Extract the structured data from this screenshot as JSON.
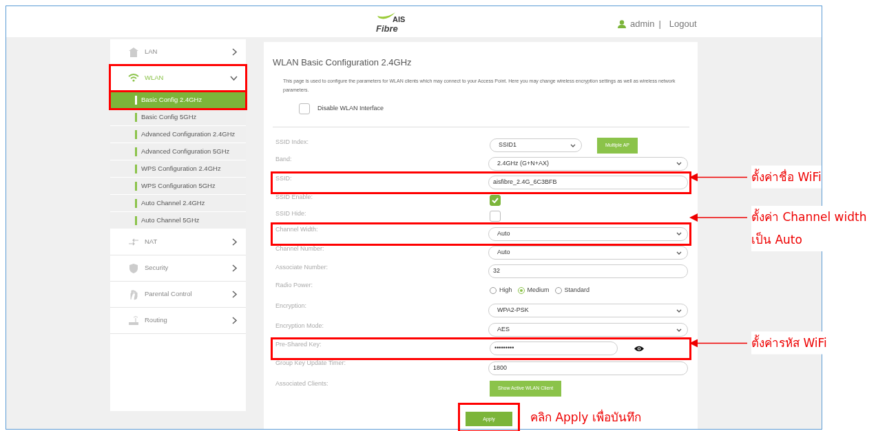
{
  "header": {
    "logo_top": "AIS",
    "logo_bottom": "Fibre",
    "user": "admin",
    "separator": "|",
    "logout": "Logout"
  },
  "sidebar": {
    "items": [
      {
        "label": "LAN",
        "expanded": false,
        "selected": false,
        "highlighted": false
      },
      {
        "label": "WLAN",
        "expanded": true,
        "selected": true,
        "highlighted": true,
        "children": [
          {
            "label": "Basic Config 2.4GHz",
            "selected": true,
            "highlighted": true
          },
          {
            "label": "Basic Config 5GHz",
            "selected": false,
            "highlighted": false
          },
          {
            "label": "Advanced Configuration 2.4GHz",
            "selected": false,
            "highlighted": false
          },
          {
            "label": "Advanced Configuration 5GHz",
            "selected": false,
            "highlighted": false
          },
          {
            "label": "WPS Configuration 2.4GHz",
            "selected": false,
            "highlighted": false
          },
          {
            "label": "WPS Configuration 5GHz",
            "selected": false,
            "highlighted": false
          },
          {
            "label": "Auto Channel 2.4GHz",
            "selected": false,
            "highlighted": false
          },
          {
            "label": "Auto Channel 5GHz",
            "selected": false,
            "highlighted": false
          }
        ]
      },
      {
        "label": "NAT",
        "expanded": false,
        "selected": false,
        "highlighted": false
      },
      {
        "label": "Security",
        "expanded": false,
        "selected": false,
        "highlighted": false
      },
      {
        "label": "Parental Control",
        "expanded": false,
        "selected": false,
        "highlighted": false
      },
      {
        "label": "Routing",
        "expanded": false,
        "selected": false,
        "highlighted": false
      }
    ]
  },
  "panel": {
    "title": "WLAN Basic Configuration 2.4GHz",
    "description": "This page is used to configure the parameters for WLAN clients which may connect to your Access Point. Here you may change wireless encryption settings as well as wireless network parameters.",
    "disable_wlan": {
      "label": "Disable WLAN Interface",
      "checked": false
    },
    "fields": [
      {
        "kind": "select",
        "label": "SSID Index:",
        "value": "SSID1",
        "button": "Multiple AP",
        "highlighted": false
      },
      {
        "kind": "select",
        "label": "Band:",
        "value": "2.4GHz (G+N+AX)",
        "highlighted": false
      },
      {
        "kind": "text",
        "label": "SSID:",
        "value": "aisfibre_2.4G_6C3BFB",
        "highlighted": true,
        "callout": "ตั้งค่าชื่อ WiFi"
      },
      {
        "kind": "checkbox",
        "label": "SSID Enable:",
        "checked": true,
        "highlighted": false
      },
      {
        "kind": "checkbox",
        "label": "SSID Hide:",
        "checked": false,
        "highlighted": false
      },
      {
        "kind": "select",
        "label": "Channel Width:",
        "value": "Auto",
        "highlighted": true,
        "callout": "ตั้งค่า Channel width\nเป็น Auto"
      },
      {
        "kind": "select",
        "label": "Channel Number:",
        "value": "Auto",
        "highlighted": false
      },
      {
        "kind": "text",
        "label": "Associate Number:",
        "value": "32",
        "highlighted": false
      },
      {
        "kind": "radios",
        "label": "Radio Power:",
        "options": [
          {
            "label": "High",
            "selected": false
          },
          {
            "label": "Medium",
            "selected": true
          },
          {
            "label": "Standard",
            "selected": false
          }
        ],
        "highlighted": false
      },
      {
        "kind": "select",
        "label": "Encryption:",
        "value": "WPA2-PSK",
        "highlighted": false
      },
      {
        "kind": "select",
        "label": "Encryption Mode:",
        "value": "AES",
        "highlighted": false
      },
      {
        "kind": "password",
        "label": "Pre-Shared Key:",
        "value": "•••••••••",
        "highlighted": true,
        "callout": "ตั้งค่ารหัส WiFi"
      },
      {
        "kind": "text",
        "label": "Group Key Update Timer:",
        "value": "1800",
        "highlighted": false
      },
      {
        "kind": "button",
        "label": "Associated Clients:",
        "button": "Show Active WLAN Client",
        "highlighted": false
      }
    ],
    "apply": {
      "label": "Apply",
      "highlighted": true,
      "callout": "คลิก Apply เพื่อบันทึก"
    }
  }
}
